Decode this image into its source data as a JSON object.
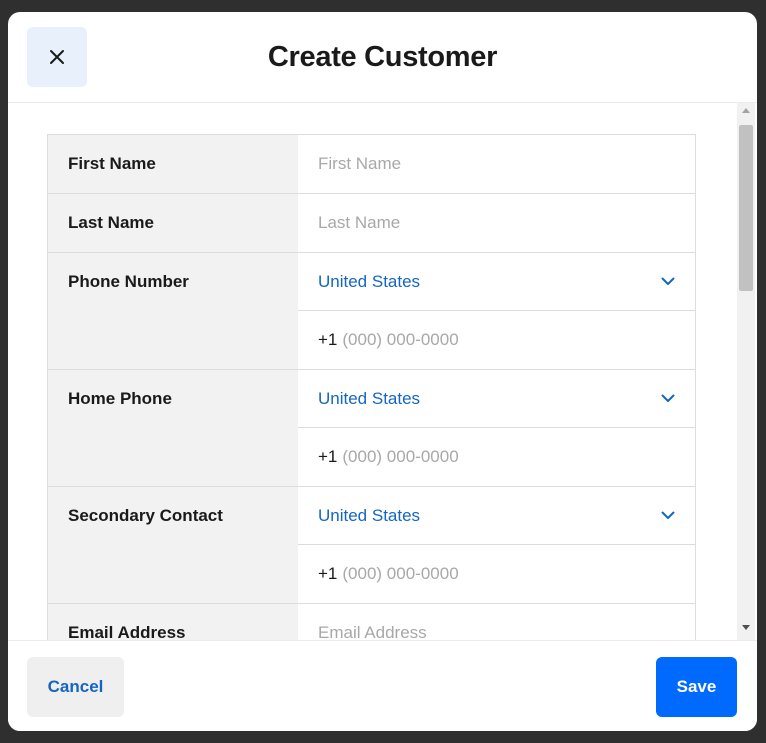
{
  "modal": {
    "title": "Create Customer",
    "close_icon": "close-icon"
  },
  "form": {
    "first_name": {
      "label": "First Name",
      "placeholder": "First Name"
    },
    "last_name": {
      "label": "Last Name",
      "placeholder": "Last Name"
    },
    "phone_number": {
      "label": "Phone Number",
      "country": "United States",
      "prefix": "+1",
      "placeholder": "(000) 000-0000"
    },
    "home_phone": {
      "label": "Home Phone",
      "country": "United States",
      "prefix": "+1",
      "placeholder": "(000) 000-0000"
    },
    "secondary_contact": {
      "label": "Secondary Contact",
      "country": "United States",
      "prefix": "+1",
      "placeholder": "(000) 000-0000"
    },
    "email": {
      "label": "Email Address",
      "placeholder": "Email Address"
    }
  },
  "footer": {
    "cancel_label": "Cancel",
    "save_label": "Save"
  },
  "colors": {
    "accent": "#006aff",
    "link": "#1466c2",
    "close_bg": "#e8f0fc"
  }
}
